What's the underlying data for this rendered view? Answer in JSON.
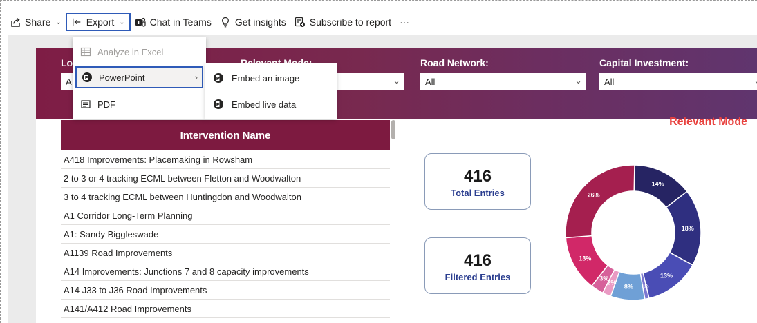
{
  "toolbar": {
    "share": "Share",
    "export": "Export",
    "chat": "Chat in Teams",
    "insights": "Get insights",
    "subscribe": "Subscribe to report",
    "more": "···"
  },
  "export_menu": {
    "items": [
      {
        "label": "Analyze in Excel",
        "icon": "excel-icon",
        "disabled": true
      },
      {
        "label": "PowerPoint",
        "icon": "powerpoint-icon",
        "has_submenu": true
      },
      {
        "label": "PDF",
        "icon": "pdf-icon"
      }
    ],
    "submenu": [
      {
        "label": "Embed an image",
        "icon": "powerpoint-icon"
      },
      {
        "label": "Embed live data",
        "icon": "powerpoint-icon"
      }
    ]
  },
  "slicers": [
    {
      "title": "Lo",
      "value": "A"
    },
    {
      "title": "Relevant Mode:",
      "value": ""
    },
    {
      "title": "Road Network:",
      "value": "All"
    },
    {
      "title": "Capital Investment:",
      "value": "All"
    }
  ],
  "table": {
    "header": "Intervention Name",
    "rows": [
      "A418 Improvements: Placemaking in Rowsham",
      "2 to 3 or 4 tracking ECML between Fletton and Woodwalton",
      "3 to 4 tracking ECML between Huntingdon and Woodwalton",
      "A1 Corridor Long-Term Planning",
      "A1: Sandy Biggleswade",
      "A1139 Road Improvements",
      "A14 Improvements: Junctions 7 and 8 capacity improvements",
      "A14 J33 to J36 Road Improvements",
      "A141/A412 Road Improvements"
    ]
  },
  "cards": [
    {
      "value": "416",
      "label": "Total Entries"
    },
    {
      "value": "416",
      "label": "Filtered Entries"
    }
  ],
  "donut": {
    "title": "Relevant Mode",
    "slices": [
      {
        "label": "14%",
        "value": 14,
        "color": "#262463"
      },
      {
        "label": "18%",
        "value": 18,
        "color": "#2f2f80"
      },
      {
        "label": "13%",
        "value": 13,
        "color": "#4a4db5"
      },
      {
        "label": "1%",
        "value": 1,
        "color": "#7b77d0"
      },
      {
        "label": "8%",
        "value": 8,
        "color": "#6fa0d6"
      },
      {
        "label": "2%",
        "value": 2,
        "color": "#e99ac3"
      },
      {
        "label": "3%",
        "value": 3,
        "color": "#d6609a"
      },
      {
        "label": "13%",
        "value": 13,
        "color": "#d12868"
      },
      {
        "label": "26%",
        "value": 26,
        "color": "#a51f4f"
      }
    ]
  }
}
